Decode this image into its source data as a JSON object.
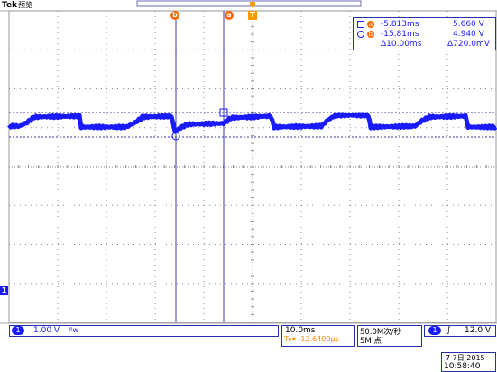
{
  "header": {
    "brand": "Tek",
    "mode": "预览"
  },
  "markers": {
    "cursor_b": "b",
    "cursor_a": "a",
    "trigger": "T",
    "channel": "1"
  },
  "readout": {
    "a_time": "-5.813ms",
    "a_volt": "5.660 V",
    "b_time": "-15.81ms",
    "b_volt": "4.940 V",
    "delta_time": "Δ10.00ms",
    "delta_volt": "Δ720.0mV"
  },
  "status": {
    "ch_num": "1",
    "ch_scale": "1.00 V",
    "ch_bw": "ᴮw",
    "timebase": "10.0ms",
    "trig_pos": "T▸▾ -12.6400µs",
    "sample_rate": "50.0M次/秒",
    "record_len": "5M 点",
    "trig_ch": "1",
    "trig_slope": "∫",
    "trig_level": "12.0 V",
    "date": "7 7日 2015",
    "time": "10:58:40"
  },
  "colors": {
    "trace": "#1a1aff",
    "grid": "#8a8a8a",
    "cursor": "#3a3aa8",
    "marker": "#ff6600"
  }
}
